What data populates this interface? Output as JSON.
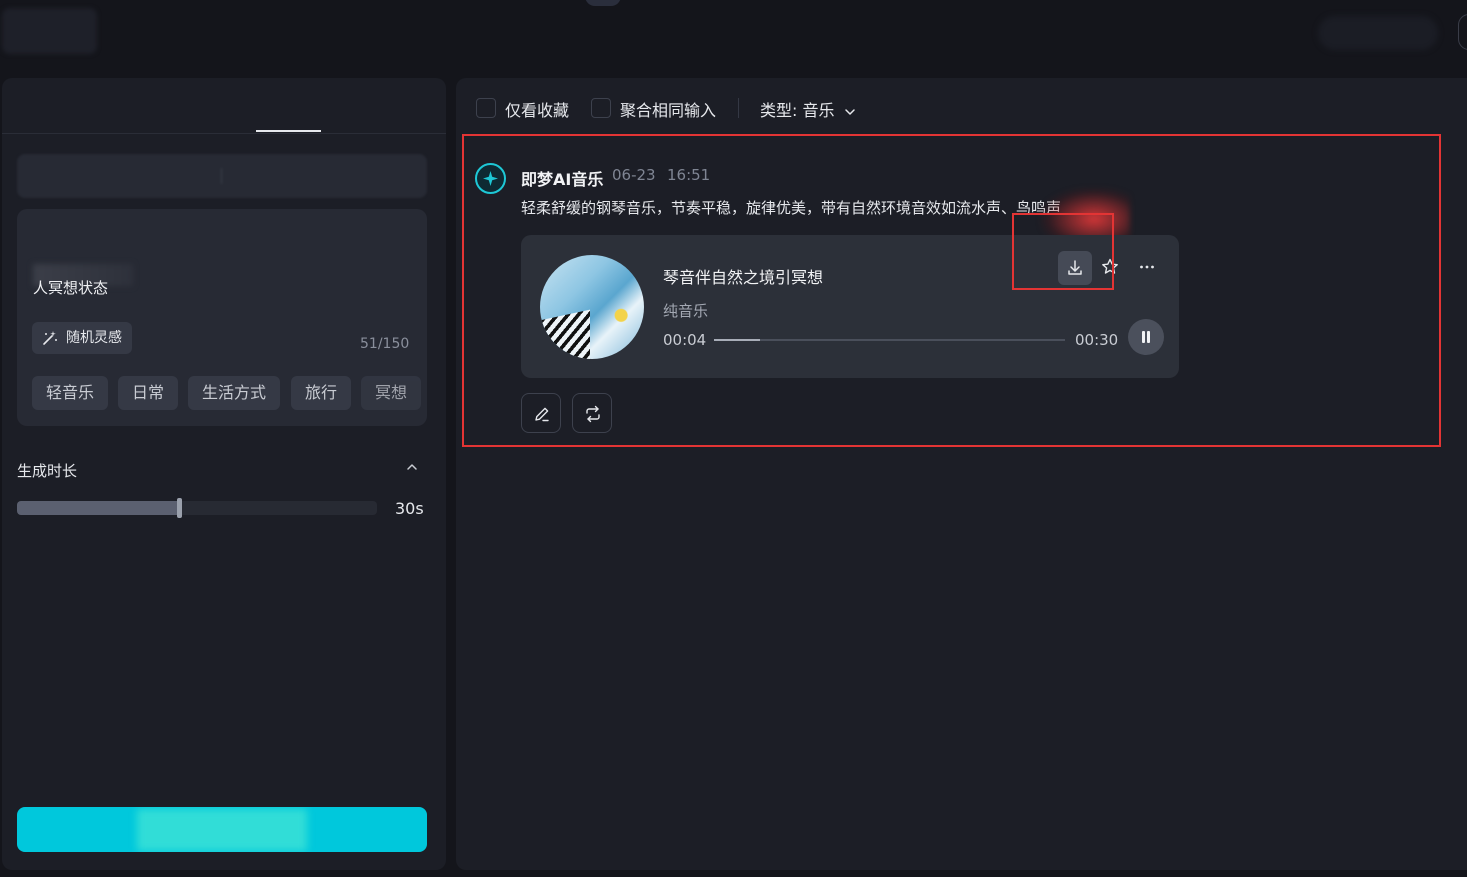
{
  "colors": {
    "accent": "#00c8dc",
    "highlight_box": "#e33434",
    "background": "#14151b",
    "panel": "#1c1e26"
  },
  "left_panel": {
    "prompt_text": "人冥想状态",
    "random_button_label": "随机灵感",
    "random_button_icon": "magic-wand-icon",
    "char_counter": "51/150",
    "chips": [
      "轻音乐",
      "日常",
      "生活方式",
      "旅行",
      "冥想"
    ],
    "duration": {
      "label": "生成时长",
      "value_label": "30s",
      "value_fraction": 0.45
    }
  },
  "filters": {
    "favorites_only_label": "仅看收藏",
    "favorites_only_checked": false,
    "merge_same_input_label": "聚合相同输入",
    "merge_same_input_checked": false,
    "type_label": "类型: 音乐"
  },
  "result": {
    "author": "即梦AI音乐",
    "date": "06-23",
    "time": "16:51",
    "description": "轻柔舒缓的钢琴音乐，节奏平稳，旋律优美，带有自然环境音效如流水声、鸟鸣声",
    "track": {
      "title": "琴音伴自然之境引冥想",
      "genre": "纯音乐",
      "current_time": "00:04",
      "total_time": "00:30",
      "progress_fraction": 0.13,
      "is_playing": true
    }
  }
}
